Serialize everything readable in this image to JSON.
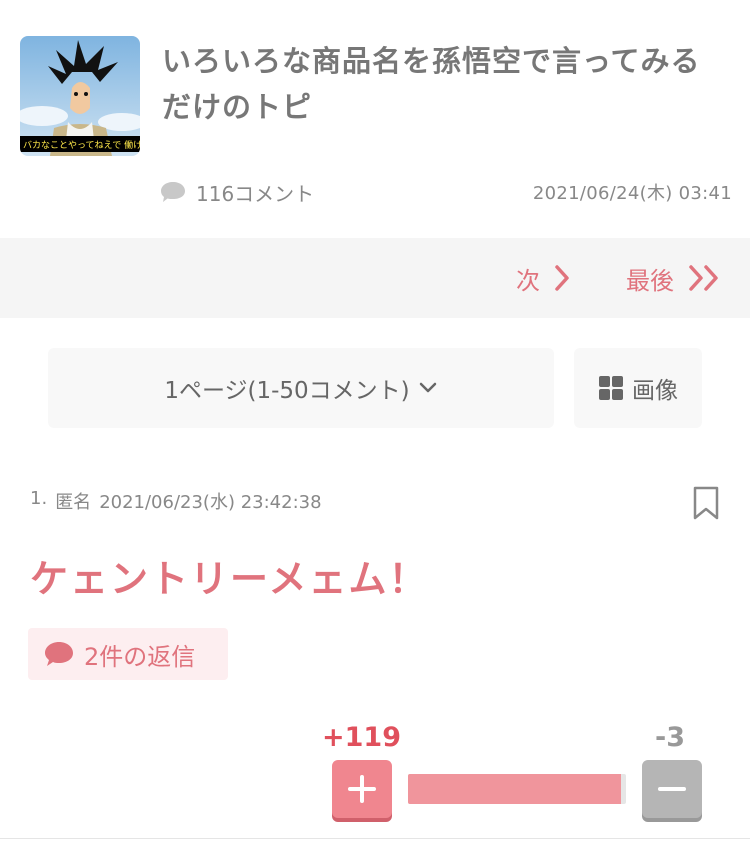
{
  "topic": {
    "title": "いろいろな商品名を孫悟空で言ってみるだけのトピ",
    "thumbnail_caption": "バカなことやってねえで 働け",
    "comment_count": "116コメント",
    "date": "2021/06/24(木) 03:41"
  },
  "pager": {
    "next_label": "次",
    "last_label": "最後"
  },
  "page_select": {
    "label": "1ページ(1-50コメント)",
    "image_label": "画像"
  },
  "comments": [
    {
      "number": "1.",
      "author": "匿名",
      "datetime": "2021/06/23(水) 23:42:38",
      "body": "ケェントリーメェム！",
      "replies": "2件の返信",
      "plus": "+119",
      "minus": "-3",
      "plus_ratio": 0.975
    }
  ],
  "colors": {
    "accent": "#e0737d",
    "plus": "#e0505c",
    "minus": "#999999",
    "pager_bg": "#f5f5f5"
  }
}
